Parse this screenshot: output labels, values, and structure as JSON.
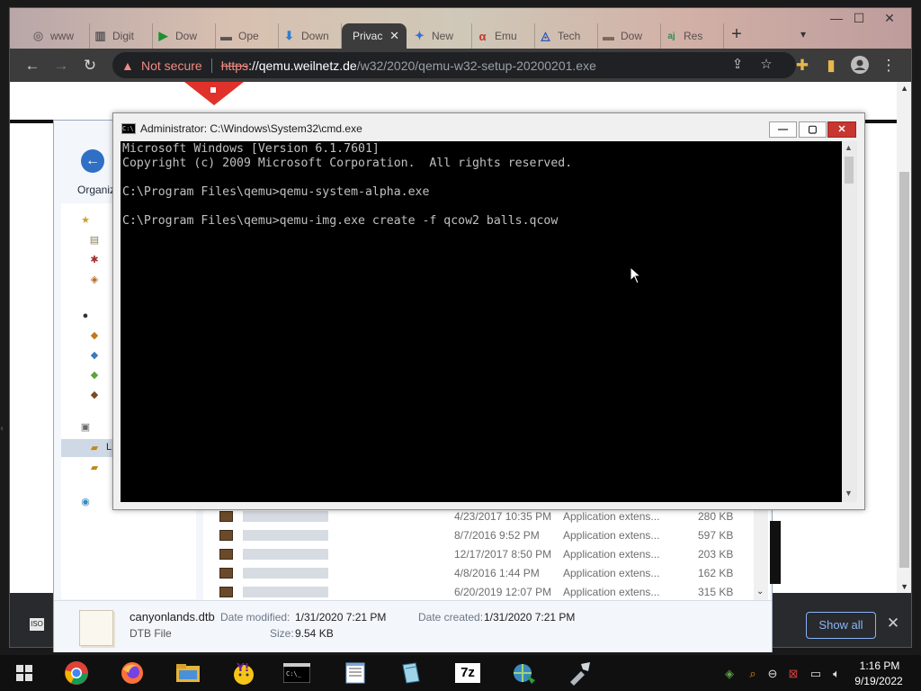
{
  "browser": {
    "window_controls": {
      "minimize": "—",
      "maximize": "☐",
      "close": "✕"
    },
    "tabs": [
      {
        "label": "www",
        "icon": "globe-icon",
        "active": false
      },
      {
        "label": "Digit",
        "icon": "archive-icon",
        "active": false
      },
      {
        "label": "Dow",
        "icon": "play-icon",
        "active": false
      },
      {
        "label": "Ope",
        "icon": "folder-icon",
        "active": false
      },
      {
        "label": "Down",
        "icon": "download-icon",
        "active": false
      },
      {
        "label": "Privac",
        "icon": "",
        "active": true
      },
      {
        "label": "New",
        "icon": "puzzle-icon",
        "active": false
      },
      {
        "label": "Emu",
        "icon": "alpha-icon",
        "active": false
      },
      {
        "label": "Tech",
        "icon": "triangle-icon",
        "active": false
      },
      {
        "label": "Dow",
        "icon": "folder-icon",
        "active": false
      },
      {
        "label": "Res",
        "icon": "aj-icon",
        "active": false
      }
    ],
    "tab_close_glyph": "✕",
    "new_tab_glyph": "+",
    "tab_search_glyph": "▾",
    "nav": {
      "back": "←",
      "forward": "→",
      "reload": "↻"
    },
    "omnibox": {
      "security_label": "Not secure",
      "url_scheme": "https",
      "url_host": "://qemu.weilnetz.de",
      "url_path": "/w32/2020/qemu-w32-setup-20200201.exe"
    },
    "toolbar_icons": [
      "share-icon",
      "star-icon",
      "extensions-icon",
      "sidebar-icon",
      "profile-icon",
      "menu-icon"
    ],
    "download_bar": {
      "show_all_label": "Show all",
      "close_glyph": "✕"
    }
  },
  "explorer": {
    "organize_label": "Organiz",
    "selected_nav_label": "L",
    "files": [
      {
        "date": "4/23/2017 10:35 PM",
        "type": "Application extens...",
        "size": "280 KB"
      },
      {
        "date": "8/7/2016 9:52 PM",
        "type": "Application extens...",
        "size": "597 KB"
      },
      {
        "date": "12/17/2017 8:50 PM",
        "type": "Application extens...",
        "size": "203 KB"
      },
      {
        "date": "4/8/2016 1:44 PM",
        "type": "Application extens...",
        "size": "162 KB"
      },
      {
        "date": "6/20/2019 12:07 PM",
        "type": "Application extens...",
        "size": "315 KB"
      }
    ],
    "status": {
      "file_name": "canyonlands.dtb",
      "file_type": "DTB File",
      "date_modified_label": "Date modified:",
      "date_modified": "1/31/2020 7:21 PM",
      "date_created_label": "Date created:",
      "date_created": "1/31/2020 7:21 PM",
      "size_label": "Size:",
      "size": "9.54 KB"
    }
  },
  "cmd": {
    "title": "Administrator: C:\\Windows\\System32\\cmd.exe",
    "buttons": {
      "minimize": "—",
      "maximize": "▢",
      "close": "✕"
    },
    "lines": [
      "Microsoft Windows [Version 6.1.7601]",
      "Copyright (c) 2009 Microsoft Corporation.  All rights reserved.",
      "",
      "C:\\Program Files\\qemu>qemu-system-alpha.exe",
      "",
      "C:\\Program Files\\qemu>qemu-img.exe create -f qcow2 balls.qcow"
    ],
    "text_color": "#c0c0c0",
    "background_color": "#000000"
  },
  "taskbar": {
    "apps": [
      "start-icon",
      "chrome-icon",
      "firefox-icon",
      "file-explorer-icon",
      "yahoo-messenger-icon",
      "cmd-icon",
      "notepad-icon",
      "reader-icon",
      "7zip-icon",
      "network-globe-icon",
      "tool-icon"
    ],
    "app_7zip_label": "7z",
    "clock": {
      "time": "1:16 PM",
      "date": "9/19/2022"
    }
  }
}
